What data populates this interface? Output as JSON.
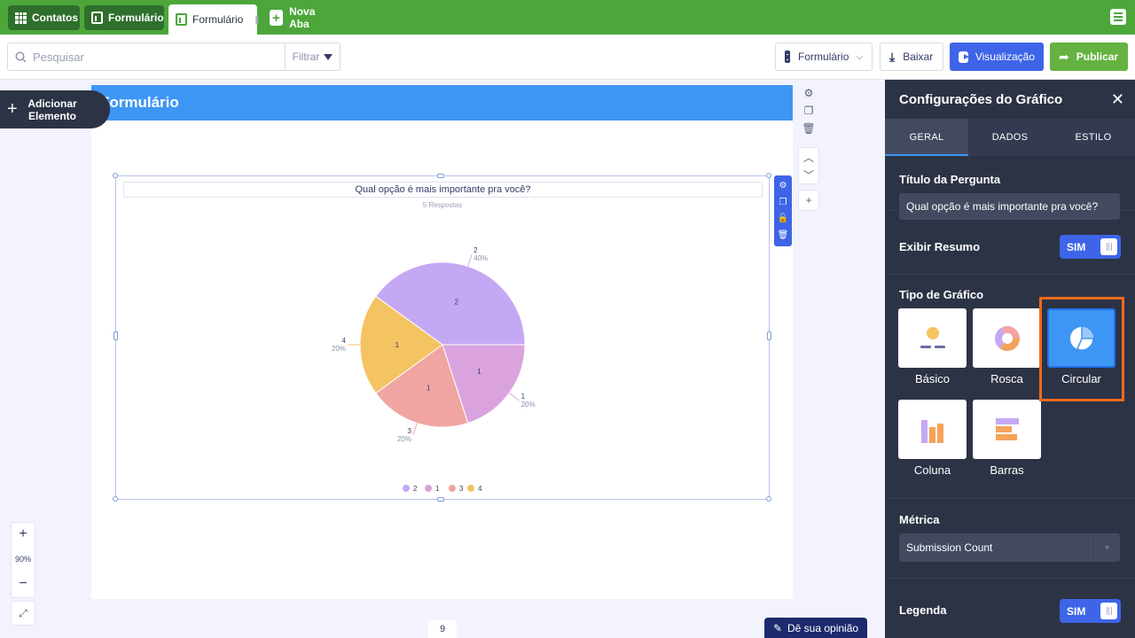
{
  "tabs": [
    {
      "label": "Contatos",
      "icon": "grid-icon"
    },
    {
      "label": "Formulário",
      "icon": "sheet-icon"
    },
    {
      "label": "Formulário",
      "icon": "sheet-icon",
      "active": true
    },
    {
      "label": "Nova Aba",
      "icon": "plus-icon"
    }
  ],
  "toolbar": {
    "search_placeholder": "Pesquisar",
    "filter_label": "Filtrar",
    "form_select": "Formulário",
    "download": "Baixar",
    "preview": "Visualização",
    "publish": "Publicar"
  },
  "canvas": {
    "header_title": "Formulário",
    "add_element": "Adicionar Elemento"
  },
  "chart": {
    "question": "Qual opção é mais importante pra você?",
    "responses": "5 Respostas"
  },
  "chart_data": {
    "type": "pie",
    "title": "Qual opção é mais importante pra você?",
    "categories": [
      "2",
      "1",
      "3",
      "4"
    ],
    "values": [
      2,
      1,
      1,
      1
    ],
    "percent_labels": [
      "40%",
      "20%",
      "20%",
      "20%"
    ],
    "colors": [
      "#c5a8f3",
      "#dba3de",
      "#f0a5a2",
      "#f4c362"
    ],
    "legend": "bottom"
  },
  "zoom": {
    "level": "90%",
    "plus": "+",
    "minus": "−"
  },
  "page_number": "9",
  "feedback": "Dê sua opinião",
  "panel": {
    "title": "Configurações do Gráfico",
    "tabs": [
      "GERAL",
      "DADOS",
      "ESTILO"
    ],
    "question_title_label": "Título da Pergunta",
    "question_title_value": "Qual opção é mais importante pra você?",
    "show_summary_label": "Exibir Resumo",
    "show_summary_value": "SIM",
    "chart_type_label": "Tipo de Gráfico",
    "chart_types": [
      "Básico",
      "Rosca",
      "Circular",
      "Coluna",
      "Barras"
    ],
    "selected_chart_type": "Circular",
    "metric_label": "Métrica",
    "metric_value": "Submission Count",
    "legend_label": "Legenda",
    "legend_value": "SIM"
  },
  "colors": {
    "topbar": "#4ca63a",
    "panel": "#2c3345",
    "accent_blue": "#3e64e7",
    "header_blue": "#3e96f4",
    "highlight": "#f06a1d"
  }
}
